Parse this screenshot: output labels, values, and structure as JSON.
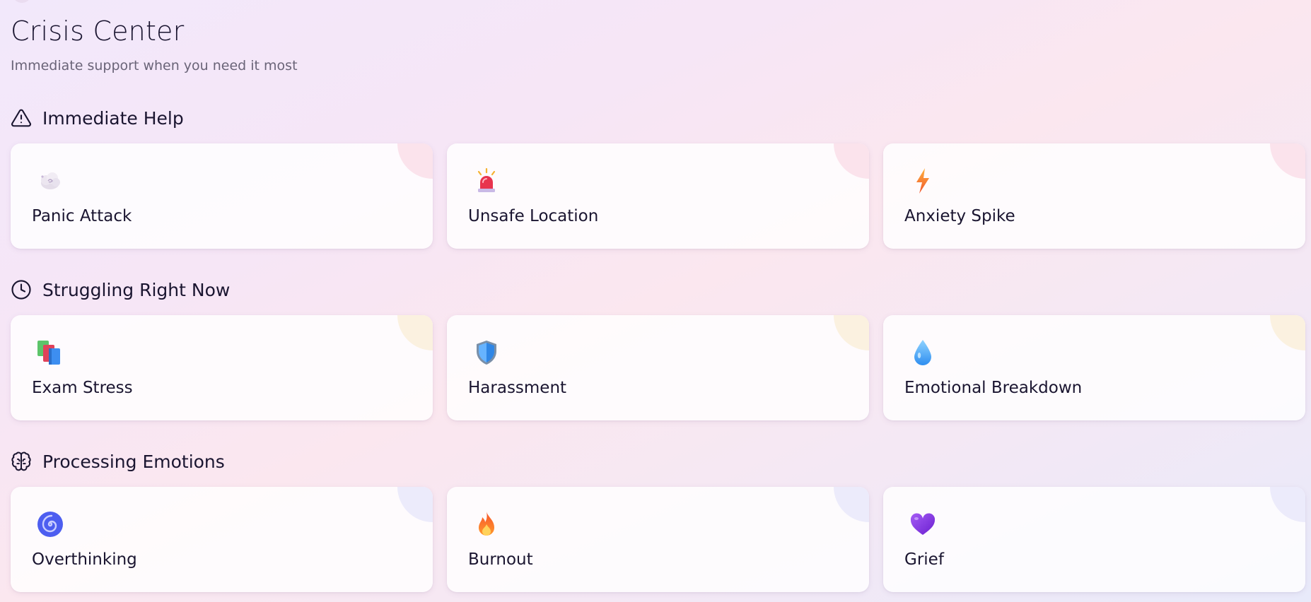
{
  "page": {
    "title": "Crisis Center",
    "subtitle": "Immediate support when you need it most"
  },
  "sections": [
    {
      "title": "Immediate Help",
      "icon": "alert-triangle-icon",
      "accent": "#fbe3ec",
      "cards": [
        {
          "label": "Panic Attack",
          "icon": "dizzy-cloud-icon"
        },
        {
          "label": "Unsafe Location",
          "icon": "police-siren-icon"
        },
        {
          "label": "Anxiety Spike",
          "icon": "lightning-bolt-icon"
        }
      ]
    },
    {
      "title": "Struggling Right Now",
      "icon": "clock-icon",
      "accent": "#fbf1e0",
      "cards": [
        {
          "label": "Exam Stress",
          "icon": "books-icon"
        },
        {
          "label": "Harassment",
          "icon": "shield-icon"
        },
        {
          "label": "Emotional Breakdown",
          "icon": "droplet-icon"
        }
      ]
    },
    {
      "title": "Processing Emotions",
      "icon": "brain-icon",
      "accent": "#ecebfb",
      "cards": [
        {
          "label": "Overthinking",
          "icon": "spiral-icon"
        },
        {
          "label": "Burnout",
          "icon": "fire-icon"
        },
        {
          "label": "Grief",
          "icon": "purple-heart-icon"
        }
      ]
    }
  ]
}
